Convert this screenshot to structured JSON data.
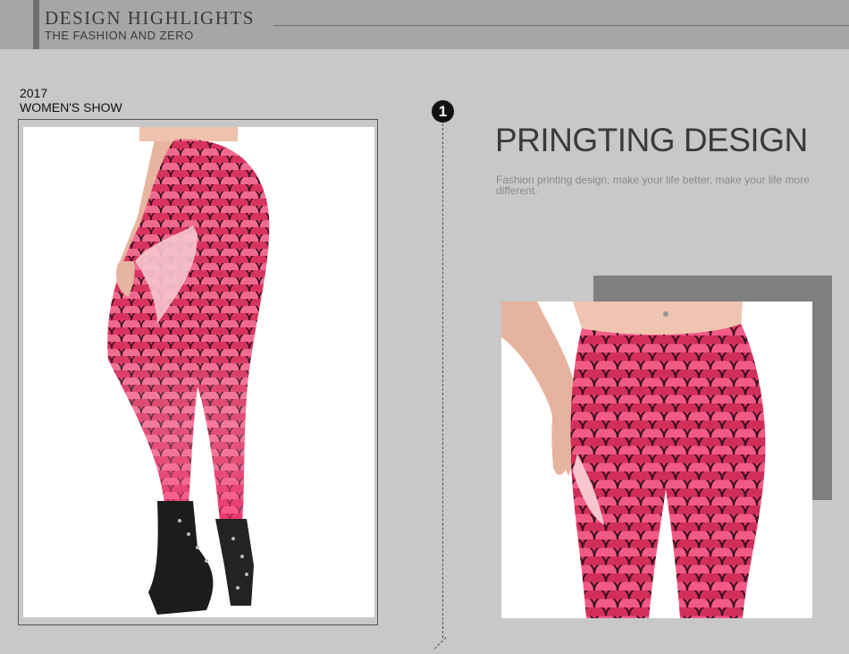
{
  "header": {
    "title": "DESIGN  HIGHLIGHTS",
    "subtitle": "THE FASHION AND ZERO"
  },
  "show": {
    "year": "2017",
    "label": "WOMEN'S SHOW"
  },
  "feature": {
    "number": "1",
    "title": "PRINGTING DESIGN",
    "description": "Fashion printing design, make your life better, make your life more different."
  },
  "colors": {
    "background": "#c8c8c8",
    "header": "#a6a6a6",
    "accent_block": "#7f7f7f",
    "scale_pink": "#e8426e"
  },
  "images": {
    "left": "mermaid-scale-leggings-side-view",
    "right": "mermaid-scale-leggings-front-closeup"
  }
}
